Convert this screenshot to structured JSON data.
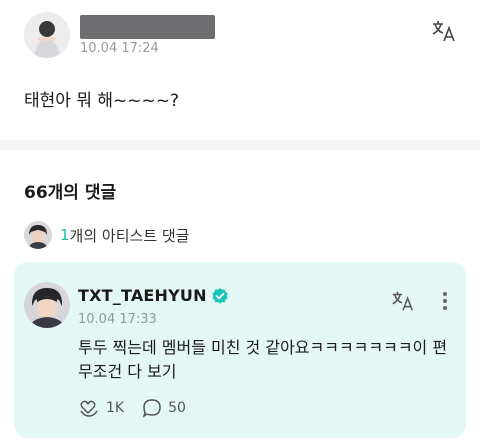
{
  "post": {
    "time": "10.04 17:24",
    "body": "태현아 뭐 해~~~~?"
  },
  "comments": {
    "count_title": "66개의 댓글",
    "artist_filter": {
      "count": "1",
      "label": "개의 아티스트 댓글"
    }
  },
  "artist_comment": {
    "author": "TXT_TAEHYUN",
    "time": "10.04 17:33",
    "text": "투두 찍는데 멤버들 미친 것 같아요ㅋㅋㅋㅋㅋㅋㅋ이 편 무조건 다 보기",
    "likes": "1K",
    "replies": "50"
  },
  "colors": {
    "accent": "#1bb6b0",
    "card_bg": "#e3f8f4",
    "verified": "#16c4b6"
  },
  "icons": {
    "translate": "translate-icon",
    "verified": "verified-badge-icon",
    "more": "more-vertical-icon",
    "like": "heart-hands-icon",
    "reply": "speech-bubble-icon"
  }
}
